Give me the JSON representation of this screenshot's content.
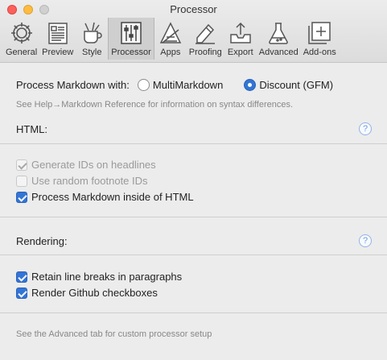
{
  "window": {
    "title": "Processor"
  },
  "toolbar": {
    "tabs": [
      {
        "label": "General",
        "icon": "gear-icon"
      },
      {
        "label": "Preview",
        "icon": "preview-icon"
      },
      {
        "label": "Style",
        "icon": "style-icon"
      },
      {
        "label": "Processor",
        "icon": "sliders-icon",
        "active": true
      },
      {
        "label": "Apps",
        "icon": "apps-icon"
      },
      {
        "label": "Proofing",
        "icon": "proofing-icon"
      },
      {
        "label": "Export",
        "icon": "export-icon"
      },
      {
        "label": "Advanced",
        "icon": "flask-icon"
      },
      {
        "label": "Add-ons",
        "icon": "add-ons-icon"
      }
    ]
  },
  "process": {
    "label": "Process Markdown with:",
    "options": [
      {
        "label": "MultiMarkdown",
        "selected": false
      },
      {
        "label": "Discount (GFM)",
        "selected": true
      }
    ],
    "hint": "See Help→Markdown Reference for information on syntax differences."
  },
  "html_section": {
    "label": "HTML:",
    "help": "?",
    "options": [
      {
        "label": "Generate IDs on headlines",
        "checked": true,
        "enabled": false
      },
      {
        "label": "Use random footnote IDs",
        "checked": false,
        "enabled": false
      },
      {
        "label": "Process Markdown inside of HTML",
        "checked": true,
        "enabled": true
      }
    ]
  },
  "rendering_section": {
    "label": "Rendering:",
    "help": "?",
    "options": [
      {
        "label": "Retain line breaks in paragraphs",
        "checked": true,
        "enabled": true
      },
      {
        "label": "Render Github checkboxes",
        "checked": true,
        "enabled": true
      }
    ]
  },
  "footer": {
    "hint": "See the Advanced tab for custom processor setup"
  },
  "colors": {
    "accent": "#3375d6",
    "hint_text": "#888888",
    "help_icon": "#6d9be0"
  }
}
